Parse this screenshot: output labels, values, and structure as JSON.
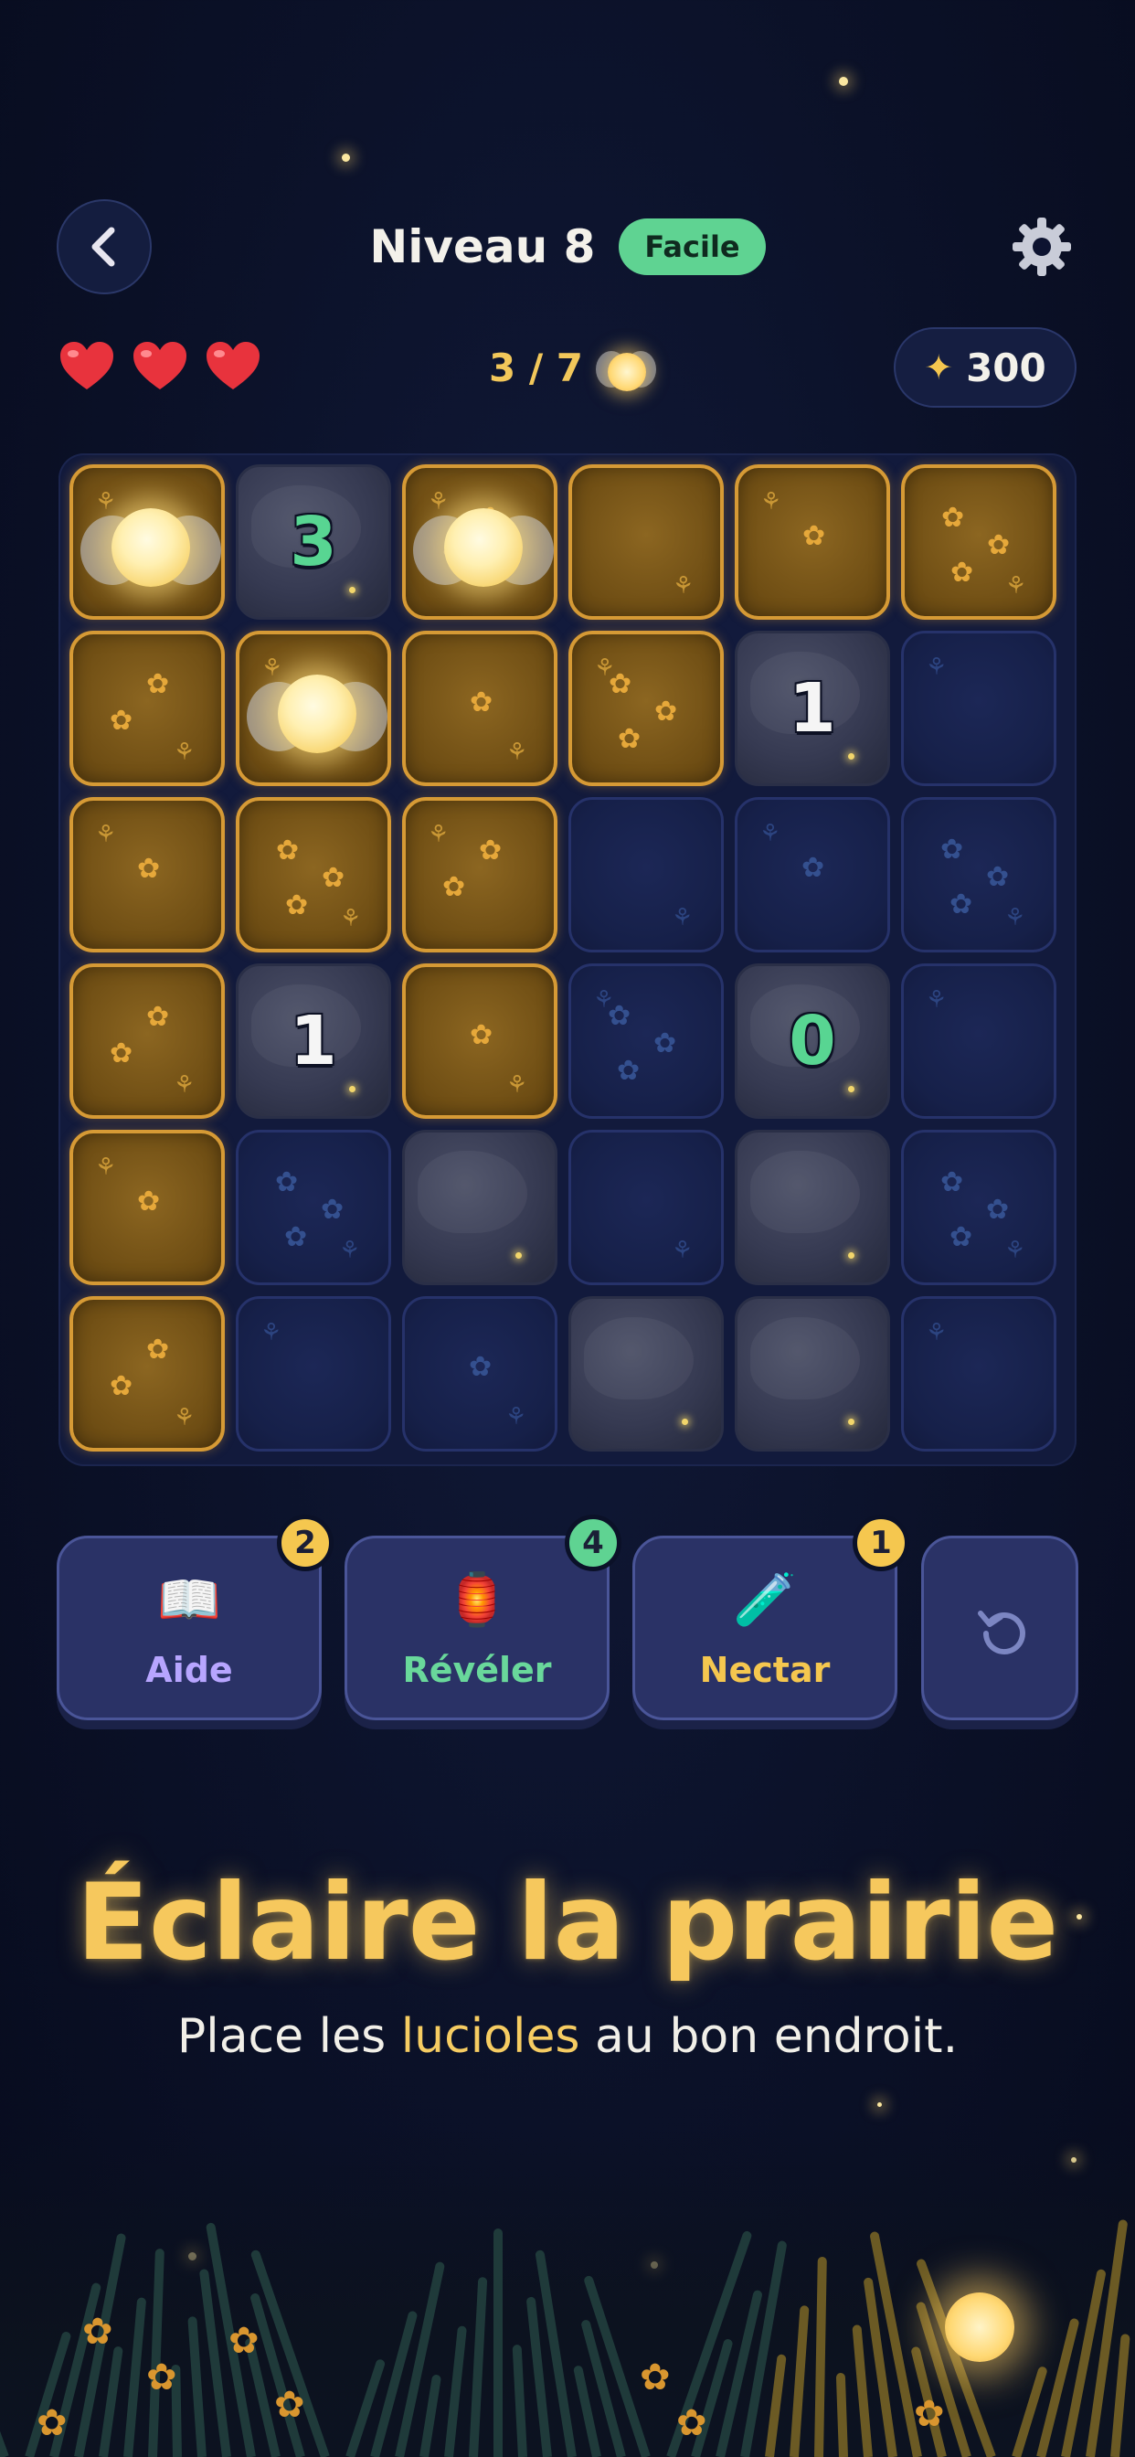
{
  "header": {
    "back_icon": "chevron-left-icon",
    "title": "Niveau 8",
    "difficulty": "Facile",
    "settings_icon": "gear-icon"
  },
  "stats": {
    "lives": 3,
    "heart_color": "#e8333d",
    "progress_text": "3 / 7",
    "coins_icon": "star-icon",
    "coins": "300"
  },
  "board": {
    "rows": [
      [
        {
          "type": "firefly"
        },
        {
          "type": "rock",
          "number": "3",
          "color": "green"
        },
        {
          "type": "firefly"
        },
        {
          "type": "grass"
        },
        {
          "type": "grass"
        },
        {
          "type": "grass"
        }
      ],
      [
        {
          "type": "grass"
        },
        {
          "type": "firefly"
        },
        {
          "type": "grass"
        },
        {
          "type": "grass"
        },
        {
          "type": "rock",
          "number": "1",
          "color": "white"
        },
        {
          "type": "dark"
        }
      ],
      [
        {
          "type": "grass"
        },
        {
          "type": "grass"
        },
        {
          "type": "grass"
        },
        {
          "type": "dark"
        },
        {
          "type": "dark"
        },
        {
          "type": "dark"
        }
      ],
      [
        {
          "type": "grass"
        },
        {
          "type": "rock",
          "number": "1",
          "color": "white"
        },
        {
          "type": "grass"
        },
        {
          "type": "dark"
        },
        {
          "type": "rock",
          "number": "0",
          "color": "green"
        },
        {
          "type": "dark"
        }
      ],
      [
        {
          "type": "grass"
        },
        {
          "type": "dark"
        },
        {
          "type": "rock"
        },
        {
          "type": "dark"
        },
        {
          "type": "rock"
        },
        {
          "type": "dark"
        }
      ],
      [
        {
          "type": "grass"
        },
        {
          "type": "dark"
        },
        {
          "type": "dark"
        },
        {
          "type": "rock"
        },
        {
          "type": "rock"
        },
        {
          "type": "dark"
        }
      ]
    ]
  },
  "tools": {
    "help": {
      "label": "Aide",
      "count": "2",
      "icon": "book-icon",
      "color": "#b7a5ff",
      "badge": "#f5c74f"
    },
    "reveal": {
      "label": "Révéler",
      "count": "4",
      "icon": "lantern-icon",
      "color": "#69d89b",
      "badge": "#5fd392"
    },
    "nectar": {
      "label": "Nectar",
      "count": "1",
      "icon": "potion-icon",
      "color": "#f5c74f",
      "badge": "#f5c74f"
    },
    "undo": {
      "icon": "undo-icon"
    }
  },
  "footer": {
    "headline": "Éclaire la prairie",
    "sub_before": "Place les ",
    "sub_highlight": "lucioles",
    "sub_after": " au bon endroit."
  }
}
